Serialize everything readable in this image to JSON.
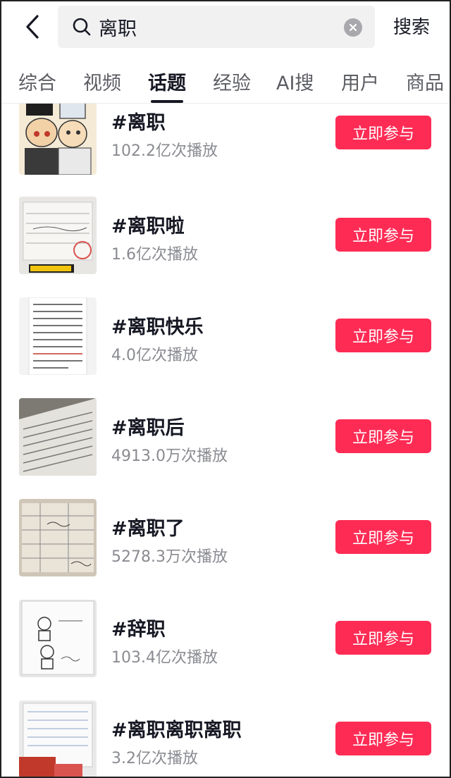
{
  "search": {
    "query": "离职",
    "submit_label": "搜索"
  },
  "tabs": [
    {
      "label": "综合",
      "active": false
    },
    {
      "label": "视频",
      "active": false
    },
    {
      "label": "话题",
      "active": true
    },
    {
      "label": "经验",
      "active": false
    },
    {
      "label": "AI搜",
      "active": false
    },
    {
      "label": "用户",
      "active": false
    },
    {
      "label": "商品",
      "active": false
    }
  ],
  "topics": [
    {
      "title": "#离职",
      "plays": "102.2亿次播放",
      "action": "立即参与"
    },
    {
      "title": "#离职啦",
      "plays": "1.6亿次播放",
      "action": "立即参与"
    },
    {
      "title": "#离职快乐",
      "plays": "4.0亿次播放",
      "action": "立即参与"
    },
    {
      "title": "#离职后",
      "plays": "4913.0万次播放",
      "action": "立即参与"
    },
    {
      "title": "#离职了",
      "plays": "5278.3万次播放",
      "action": "立即参与"
    },
    {
      "title": "#辞职",
      "plays": "103.4亿次播放",
      "action": "立即参与"
    },
    {
      "title": "#离职离职离职",
      "plays": "3.2亿次播放",
      "action": "立即参与"
    }
  ],
  "colors": {
    "accent": "#fe2c55",
    "text_primary": "#161823",
    "text_secondary": "#8a8b91",
    "search_bg": "#f1f1f2"
  }
}
